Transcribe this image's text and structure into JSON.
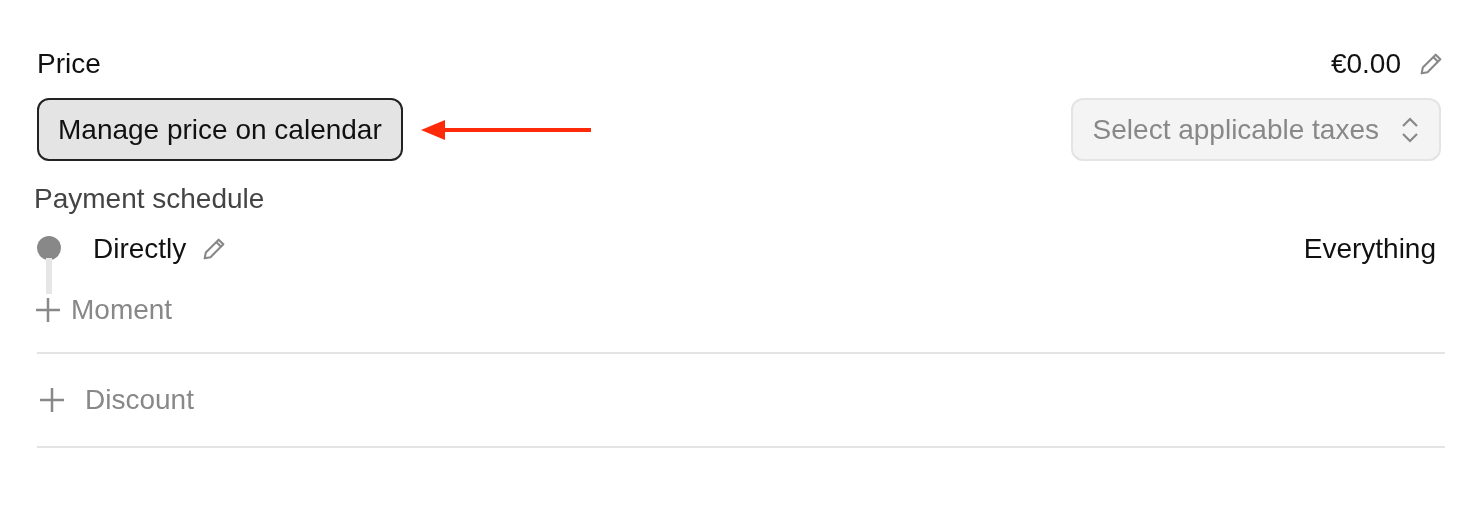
{
  "price": {
    "label": "Price",
    "value": "€0.00"
  },
  "calendar_button": {
    "label": "Manage price on calendar"
  },
  "taxes_select": {
    "placeholder": "Select applicable taxes"
  },
  "payment_schedule": {
    "title": "Payment schedule",
    "moments": [
      {
        "label": "Directly",
        "amount": "Everything"
      }
    ],
    "add_label": "Moment"
  },
  "discount": {
    "add_label": "Discount"
  }
}
